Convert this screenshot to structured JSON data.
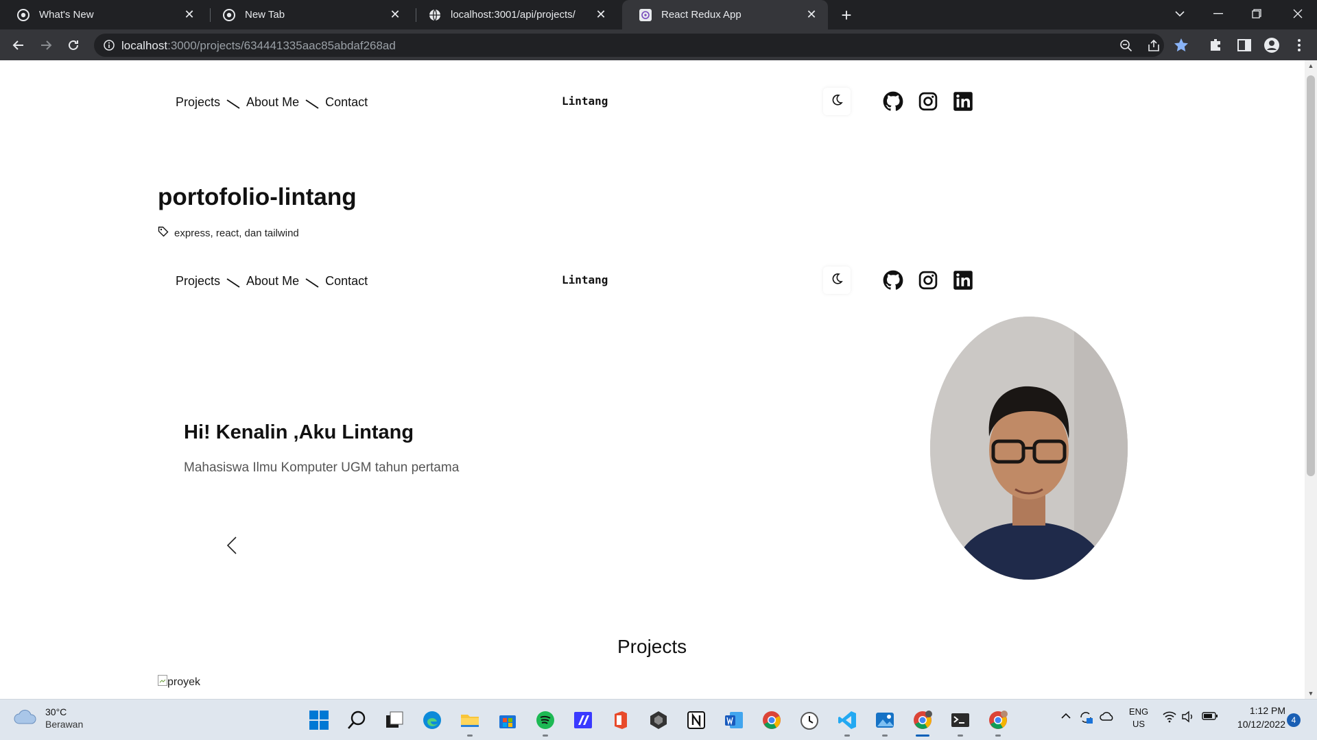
{
  "browser": {
    "tabs": [
      {
        "title": "What's New",
        "active": false
      },
      {
        "title": "New Tab",
        "active": false
      },
      {
        "title": "localhost:3001/api/projects/",
        "active": false
      },
      {
        "title": "React Redux App",
        "active": true
      }
    ],
    "url_host": "localhost",
    "url_rest": ":3000/projects/634441335aac85abdaf268ad"
  },
  "nav": {
    "links": [
      "Projects",
      "About Me",
      "Contact"
    ],
    "brand": "Lintang"
  },
  "project": {
    "title": "portofolio-lintang",
    "tags": "express, react, dan tailwind"
  },
  "hero": {
    "heading": "Hi! Kenalin ,Aku Lintang",
    "subtitle": "Mahasiswa Ilmu Komputer UGM tahun pertama"
  },
  "projects_section": {
    "heading": "Projects",
    "broken_image_alt": "proyek"
  },
  "taskbar": {
    "weather_temp": "30°C",
    "weather_desc": "Berawan",
    "lang_1": "ENG",
    "lang_2": "US",
    "time": "1:12 PM",
    "date": "10/12/2022",
    "notification_count": "4"
  },
  "colors": {
    "chrome_dark": "#202124",
    "chrome_toolbar": "#35363a",
    "taskbar_bg": "#dfe6ee",
    "accent_blue": "#005fb8"
  }
}
